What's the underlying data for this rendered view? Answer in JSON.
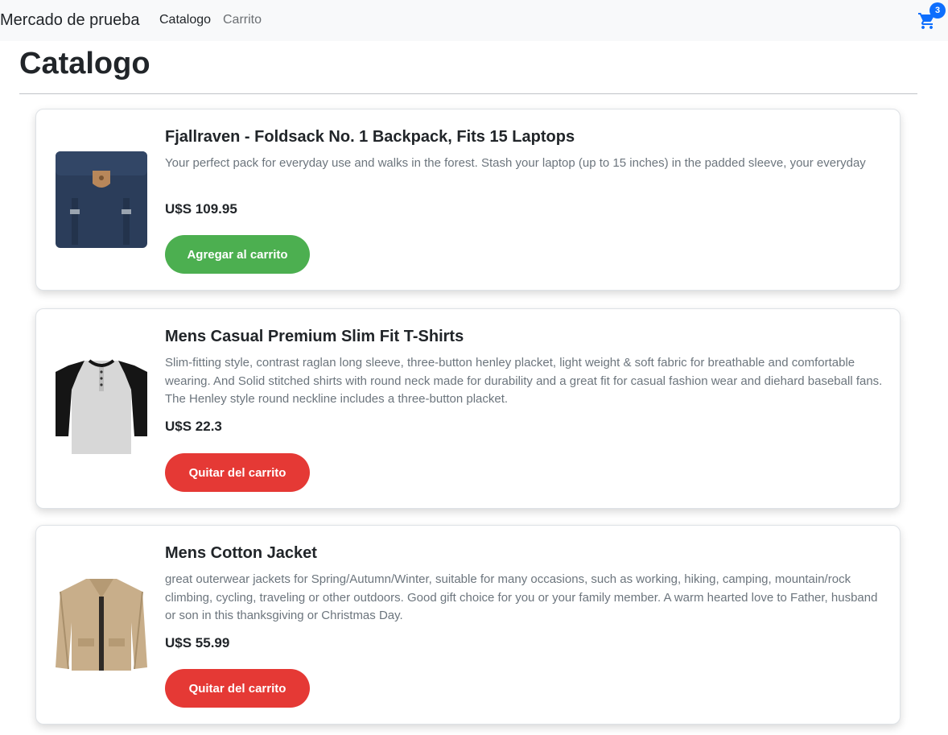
{
  "navbar": {
    "brand": "Mercado de prueba",
    "links": [
      "Catalogo",
      "Carrito"
    ],
    "cart_count": "3",
    "cart_icon": "cart-icon",
    "accent": "#0d6efd"
  },
  "page": {
    "title": "Catalogo"
  },
  "products": [
    {
      "title": "Fjallraven - Foldsack No. 1 Backpack, Fits 15 Laptops",
      "description": "Your perfect pack for everyday use and walks in the forest. Stash your laptop (up to 15 inches) in the padded sleeve, your everyday",
      "price": "U$S 109.95",
      "button": "Agregar al carrito",
      "button_color": "#4caf50",
      "image": "backpack-image"
    },
    {
      "title": "Mens Casual Premium Slim Fit T-Shirts",
      "description": "Slim-fitting style, contrast raglan long sleeve, three-button henley placket, light weight & soft fabric for breathable and comfortable wearing. And Solid stitched shirts with round neck made for durability and a great fit for casual fashion wear and diehard baseball fans. The Henley style round neckline includes a three-button placket.",
      "price": "U$S 22.3",
      "button": "Quitar del carrito",
      "button_color": "#e53935",
      "image": "tshirt-image"
    },
    {
      "title": "Mens Cotton Jacket",
      "description": "great outerwear jackets for Spring/Autumn/Winter, suitable for many occasions, such as working, hiking, camping, mountain/rock climbing, cycling, traveling or other outdoors. Good gift choice for you or your family member. A warm hearted love to Father, husband or son in this thanksgiving or Christmas Day.",
      "price": "U$S 55.99",
      "button": "Quitar del carrito",
      "button_color": "#e53935",
      "image": "jacket-image"
    }
  ]
}
